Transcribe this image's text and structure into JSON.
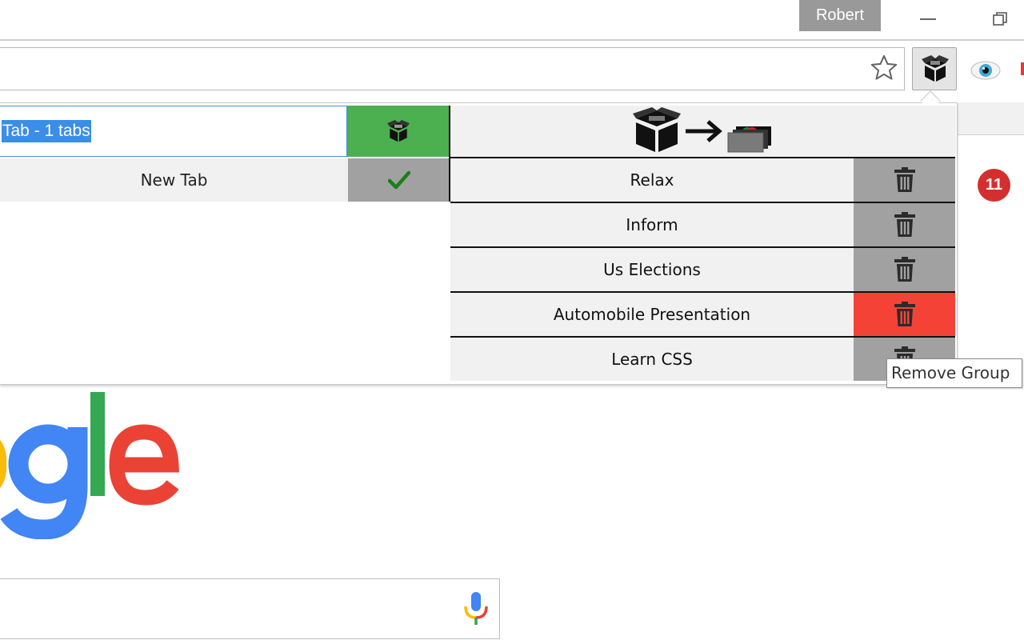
{
  "window": {
    "profile_name": "Robert"
  },
  "toolbar": {
    "star_icon": "star-outline-icon",
    "extension_icon": "box-icon",
    "eye_extension_icon": "eye-icon"
  },
  "popup": {
    "group_name_value": "Tab - 1 tabs",
    "save_button_icon": "box-icon",
    "current_tabs": [
      {
        "label": "New Tab",
        "status_icon": "checkmark-icon"
      }
    ],
    "groups_header_icon": "box-to-cards-icon",
    "groups": [
      {
        "label": "Relax",
        "delete_icon": "trash-icon",
        "hover": false
      },
      {
        "label": "Inform",
        "delete_icon": "trash-icon",
        "hover": false
      },
      {
        "label": "Us Elections",
        "delete_icon": "trash-icon",
        "hover": false
      },
      {
        "label": "Automobile Presentation",
        "delete_icon": "trash-icon",
        "hover": true
      },
      {
        "label": "Learn CSS",
        "delete_icon": "trash-icon",
        "hover": false
      }
    ],
    "tooltip": "Remove Group"
  },
  "notification_badge": {
    "count": "11"
  },
  "colors": {
    "save_green": "#4caf50",
    "delete_grey": "#a1a1a1",
    "delete_hover_red": "#f44336",
    "badge_red": "#d32f2f",
    "selection_blue": "#3b8ee8"
  }
}
